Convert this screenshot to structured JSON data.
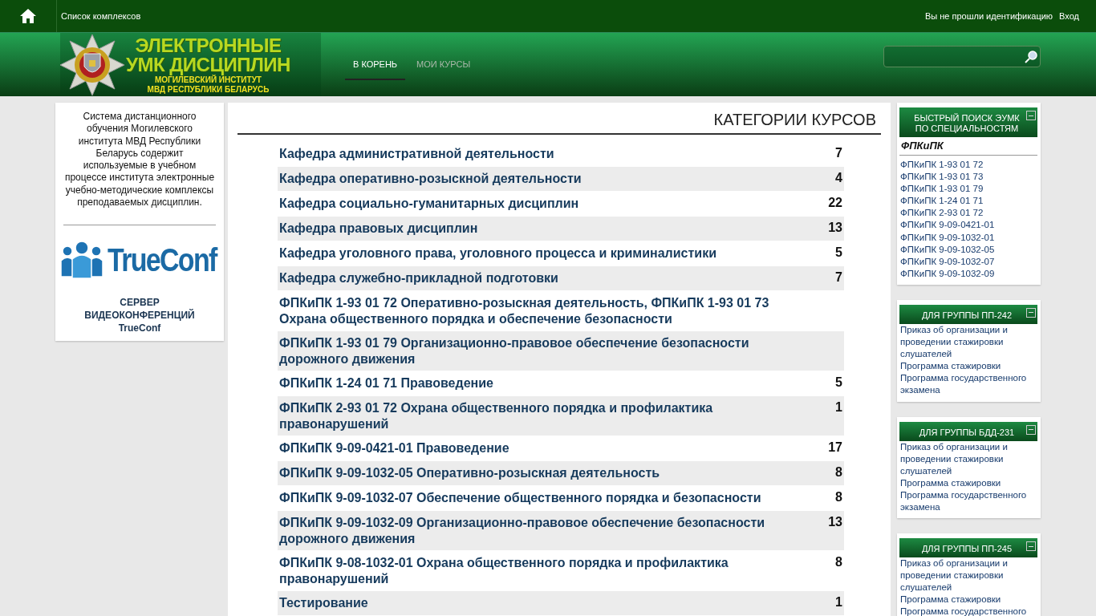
{
  "topbar": {
    "breadcrumb": "Список комплексов",
    "login_status": "Вы не прошли идентификацию",
    "login_link": "Вход"
  },
  "header": {
    "logo_title": [
      "ЭЛЕКТРОННЫЕ",
      "УМК ДИСЦИПЛИН"
    ],
    "logo_subtitle": [
      "МОГИЛЕВСКИЙ ИНСТИТУТ",
      "МВД РЕСПУБЛИКИ БЕЛАРУСЬ"
    ],
    "nav": [
      {
        "label": "В КОРЕНЬ",
        "selected": true
      },
      {
        "label": "МОИ КУРСЫ",
        "selected": false
      }
    ]
  },
  "left_panel": {
    "description": "Система дистанционного обучения Могилевского института МВД Республики Беларусь содержит используемые в учебном процессе института электронные учебно-методические комплексы преподаваемых дисциплин.",
    "logo_text": "TrueConf",
    "caption": [
      "СЕРВЕР",
      "ВИДЕОКОНФЕРЕНЦИЙ",
      "TrueConf"
    ]
  },
  "main": {
    "title": "КАТЕГОРИИ КУРСОВ",
    "categories": [
      {
        "name": "Кафедра административной деятельности",
        "count": "7"
      },
      {
        "name": "Кафедра оперативно-розыскной деятельности",
        "count": "4"
      },
      {
        "name": "Кафедра социально-гуманитарных дисциплин",
        "count": "22"
      },
      {
        "name": "Кафедра правовых дисциплин",
        "count": "13"
      },
      {
        "name": "Кафедра уголовного права, уголовного процесса и криминалистики",
        "count": "5"
      },
      {
        "name": "Кафедра служебно-прикладной подготовки",
        "count": "7"
      },
      {
        "name": "ФПКиПК 1-93 01 72 Оперативно-розыскная деятельность, ФПКиПК 1-93 01 73 Охрана общественного порядка и обеспечение безопасности"
      },
      {
        "name": "ФПКиПК 1-93 01 79 Организационно-правовое обеспечение безопасности дорожного движения"
      },
      {
        "name": "ФПКиПК 1-24 01 71 Правоведение",
        "count": "5"
      },
      {
        "name": "ФПКиПК 2-93 01 72 Охрана общественного порядка и профилактика правонарушений",
        "count": "1"
      },
      {
        "name": "ФПКиПК 9-09-0421-01 Правоведение",
        "count": "17"
      },
      {
        "name": "ФПКиПК 9-09-1032-05 Оперативно-розыскная деятельность",
        "count": "8"
      },
      {
        "name": "ФПКиПК 9-09-1032-07 Обеспечение общественного порядка и безопасности",
        "count": "8"
      },
      {
        "name": "ФПКиПК 9-09-1032-09 Организационно-правовое обеспечение безопасности дорожного движения",
        "count": "13"
      },
      {
        "name": "ФПКиПК 9-08-1032-01 Охрана общественного порядка и профилактика правонарушений",
        "count": "8"
      },
      {
        "name": "Тестирование",
        "count": "1"
      }
    ]
  },
  "right_blocks": [
    {
      "title": [
        "БЫСТРЫЙ ПОИСК ЭУМК",
        "ПО СПЕЦИАЛЬНОСТЯМ"
      ],
      "subheading": "ФПКиПК",
      "links": [
        "ФПКиПК 1-93 01 72",
        "ФПКиПК 1-93 01 73",
        "ФПКиПК 1-93 01 79",
        "ФПКиПК 1-24 01 71",
        "ФПКиПК 2-93 01 72",
        "ФПКиПК 9-09-0421-01",
        "ФПКиПК 9-09-1032-01",
        "ФПКиПК 9-09-1032-05",
        "ФПКиПК 9-09-1032-07",
        "ФПКиПК 9-09-1032-09"
      ]
    },
    {
      "title": [
        "ДЛЯ ГРУППЫ ПП-242"
      ],
      "links": [
        "Приказ об организации и проведении стажировки слушателей",
        "Программа стажировки",
        "Программа государственного экзамена"
      ]
    },
    {
      "title": [
        "ДЛЯ ГРУППЫ БДД-231"
      ],
      "links": [
        "Приказ об организации и проведении стажировки слушателей",
        "Программа стажировки",
        "Программа государственного экзамена"
      ]
    },
    {
      "title": [
        "ДЛЯ ГРУППЫ ПП-245"
      ],
      "links": [
        "Приказ об организации и проведении стажировки слушателей",
        "Программа стажировки",
        "Программа государственного"
      ]
    }
  ]
}
